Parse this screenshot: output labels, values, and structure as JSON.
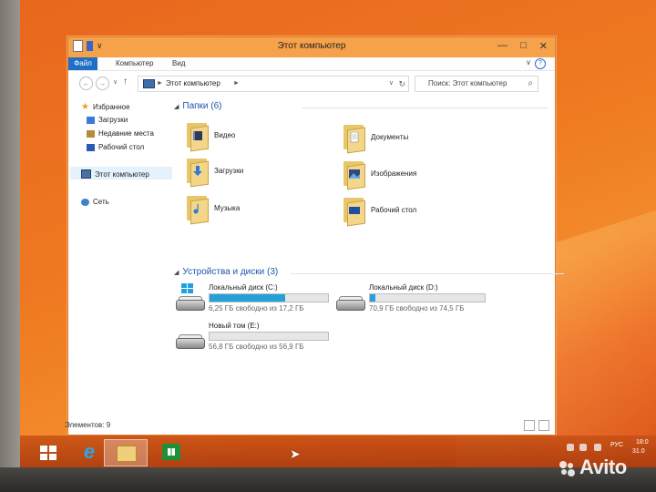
{
  "window": {
    "title": "Этот компьютер",
    "qat_caret": "∨",
    "controls": {
      "minimize": "—",
      "maximize": "□",
      "close": "✕"
    }
  },
  "ribbon": {
    "tabs": [
      "Файл",
      "Компьютер",
      "Вид"
    ],
    "help": "?"
  },
  "navigation": {
    "back": "←",
    "forward": "→",
    "up": "↑",
    "address": "Этот компьютер",
    "search_placeholder": "Поиск: Этот компьютер"
  },
  "nav_pane": {
    "favorites": "Избранное",
    "items": [
      "Загрузки",
      "Недавние места",
      "Рабочий стол"
    ],
    "this_pc": "Этот компьютер",
    "network": "Сеть"
  },
  "folders_group": {
    "title": "Папки (6)",
    "items": [
      "Видео",
      "Документы",
      "Загрузки",
      "Изображения",
      "Музыка",
      "Рабочий стол"
    ]
  },
  "drives_group": {
    "title": "Устройства и диски (3)",
    "items": [
      {
        "name": "Локальный диск (C:)",
        "free": "6,25 ГБ свободно из 17,2 ГБ",
        "used_fraction": 0.64
      },
      {
        "name": "Локальный диск (D:)",
        "free": "70,9 ГБ свободно из 74,5 ГБ",
        "used_fraction": 0.05
      },
      {
        "name": "Новый том (E:)",
        "free": "56,8 ГБ свободно из 56,9 ГБ",
        "used_fraction": 0.0
      }
    ]
  },
  "status": {
    "count": "Элементов: 9"
  },
  "tray": {
    "lang": "РУС",
    "time": "18:0",
    "date": "31.0"
  },
  "watermark": "Avito",
  "colors": {
    "accent": "#1f6fc6",
    "titlebar": "#f6a24a",
    "drive_fill": "#27a0da",
    "desktop": "#ef7a22"
  }
}
